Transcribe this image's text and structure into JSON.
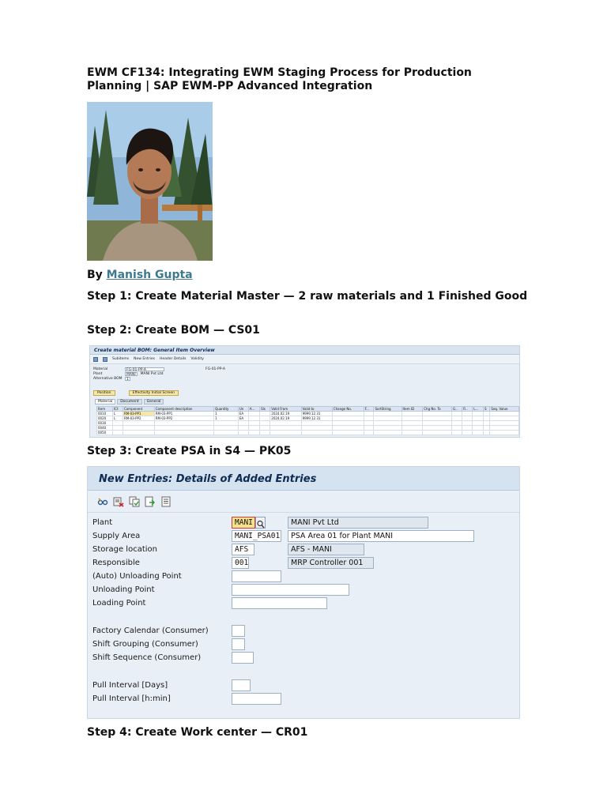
{
  "article": {
    "title": "EWM CF134: Integrating EWM Staging Process for Production Planning | SAP EWM-PP Advanced Integration",
    "by_label": "By",
    "author": "Manish Gupta",
    "step1": "Step 1: Create Material Master — 2 raw materials and 1 Finished Good",
    "step2": "Step 2: Create BOM — CS01",
    "step3": "Step 3: Create PSA in S4 — PK05",
    "step4": "Step 4: Create Work center — CR01"
  },
  "bom_screen": {
    "title": "Create material BOM: General Item Overview",
    "toolbar": [
      "Subitems",
      "New Entries",
      "Header Details",
      "Validity"
    ],
    "material_label": "Material",
    "material_value": "FG-01-PP-A",
    "material_desc": "FG-01-PP-A",
    "plant_label": "Plant",
    "plant_value": "MANI",
    "plant_desc": "MANI Pvt Ltd",
    "altbom_label": "Alternative BOM",
    "altbom_value": "1",
    "buttons": [
      "Position",
      "Effectivity Initial Screen"
    ],
    "tabs": [
      "Material",
      "Document",
      "General"
    ],
    "columns": [
      "Item",
      "ICt",
      "Component",
      "Component description",
      "Quantity",
      "Un",
      "A...",
      "Sls",
      "Valid From",
      "Valid to",
      "Change No.",
      "F...",
      "SortString",
      "Item ID",
      "Chg No. To",
      "G..",
      "Fi..",
      "L...",
      "S",
      "Seq. Value"
    ],
    "rows": [
      [
        "0010",
        "L",
        "RM-03-PP1",
        "RM-03-PP1",
        "1",
        "EA",
        "",
        "",
        "2024.02.19",
        "9999.12.31"
      ],
      [
        "0020",
        "L",
        "RM-03-PP2",
        "RM-03-PP2",
        "1",
        "EA",
        "",
        "",
        "2024.02.19",
        "9999.12.31"
      ],
      [
        "0030",
        "",
        "",
        "",
        "",
        "",
        "",
        "",
        "",
        ""
      ],
      [
        "0040",
        "",
        "",
        "",
        "",
        "",
        "",
        "",
        "",
        ""
      ],
      [
        "0050",
        "",
        "",
        "",
        "",
        "",
        "",
        "",
        "",
        ""
      ]
    ]
  },
  "psa_screen": {
    "title": "New Entries: Details of Added Entries",
    "fields": {
      "plant_label": "Plant",
      "plant_value": "MANI",
      "plant_desc": "MANI Pvt Ltd",
      "supply_label": "Supply Area",
      "supply_value": "MANI_PSA01",
      "supply_desc": "PSA Area 01 for Plant MANI",
      "storage_label": "Storage location",
      "storage_value": "AFS",
      "storage_desc": "AFS - MANI",
      "resp_label": "Responsible",
      "resp_value": "001",
      "resp_desc": "MRP Controller 001",
      "auto_unload_label": "(Auto) Unloading Point",
      "unload_label": "Unloading Point",
      "loading_label": "Loading Point",
      "factory_cal_label": "Factory Calendar (Consumer)",
      "shift_group_label": "Shift Grouping (Consumer)",
      "shift_seq_label": "Shift Sequence (Consumer)",
      "pull_days_label": "Pull Interval [Days]",
      "pull_hmin_label": "Pull Interval [h:min]"
    }
  }
}
